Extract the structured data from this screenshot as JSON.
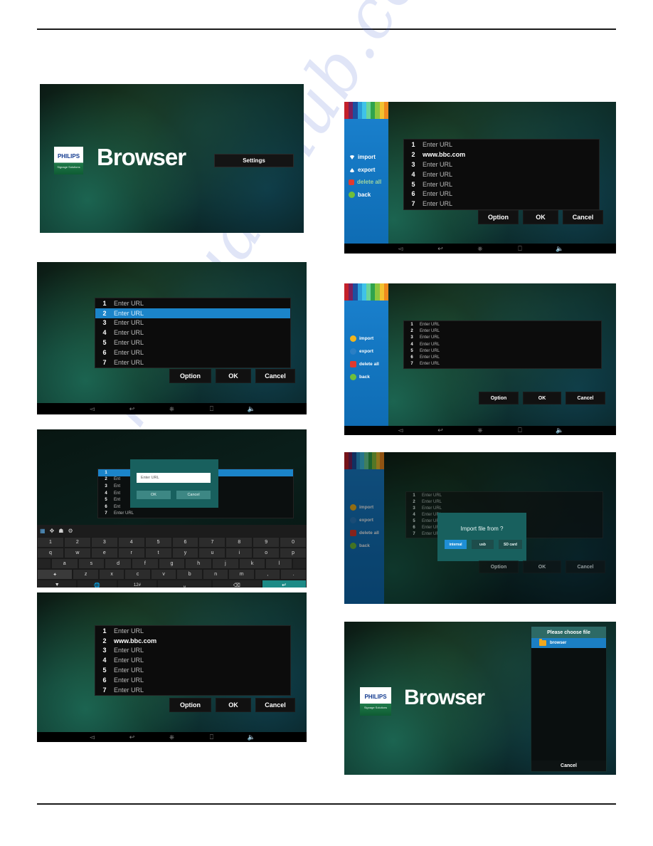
{
  "watermark": "manualshub.com",
  "common": {
    "enter_url": "Enter URL",
    "bbc_url": "www.bbc.com",
    "option": "Option",
    "ok": "OK",
    "cancel": "Cancel",
    "brand": "PHILIPS",
    "brand_tagline": "Signage Solutions",
    "app_title": "Browser",
    "nav_icons": [
      "back-icon",
      "recent-icon",
      "home-icon",
      "apps-icon",
      "volume-icon"
    ]
  },
  "shot1": {
    "name": "browser-home",
    "title": "Browser",
    "settings_label": "Settings"
  },
  "shot2": {
    "name": "url-list-selected",
    "rows": [
      {
        "index": "1",
        "text": "Enter URL",
        "selected": false
      },
      {
        "index": "2",
        "text": "Enter URL",
        "selected": true
      },
      {
        "index": "3",
        "text": "Enter URL",
        "selected": false
      },
      {
        "index": "4",
        "text": "Enter URL",
        "selected": false
      },
      {
        "index": "5",
        "text": "Enter URL",
        "selected": false
      },
      {
        "index": "6",
        "text": "Enter URL",
        "selected": false
      },
      {
        "index": "7",
        "text": "Enter URL",
        "selected": false
      }
    ],
    "buttons": [
      "Option",
      "OK",
      "Cancel"
    ]
  },
  "shot3": {
    "name": "url-keyboard-dialog",
    "dialog": {
      "input_placeholder": "Enter URL",
      "ok": "OK",
      "cancel": "Cancel"
    },
    "rows": [
      "1",
      "2",
      "3",
      "4",
      "5",
      "6",
      "7"
    ],
    "last_row_text": "Enter URL",
    "keyboard": {
      "row_num": [
        "1",
        "2",
        "3",
        "4",
        "5",
        "6",
        "7",
        "8",
        "9",
        "0"
      ],
      "row_q": [
        "q",
        "w",
        "e",
        "r",
        "t",
        "y",
        "u",
        "i",
        "o",
        "p"
      ],
      "row_a": [
        "a",
        "s",
        "d",
        "f",
        "g",
        "h",
        "j",
        "k",
        "l"
      ],
      "row_z": [
        "z",
        "x",
        "c",
        "v",
        "b",
        "n",
        "m",
        ",",
        "."
      ],
      "shift_key": "shift-icon",
      "bottom": [
        "hide-keyboard-icon",
        "globe-icon",
        "12#",
        "space-icon",
        "backspace-icon",
        "enter-icon"
      ],
      "toolbar_icons": [
        "input-method-icon",
        "move-icon",
        "home-icon",
        "settings-icon"
      ]
    }
  },
  "shot4": {
    "name": "url-list-bbc",
    "rows": [
      {
        "index": "1",
        "text": "Enter URL",
        "filled": false
      },
      {
        "index": "2",
        "text": "www.bbc.com",
        "filled": true
      },
      {
        "index": "3",
        "text": "Enter URL",
        "filled": false
      },
      {
        "index": "4",
        "text": "Enter URL",
        "filled": false
      },
      {
        "index": "5",
        "text": "Enter URL",
        "filled": false
      },
      {
        "index": "6",
        "text": "Enter URL",
        "filled": false
      },
      {
        "index": "7",
        "text": "Enter URL",
        "filled": false
      }
    ],
    "buttons": [
      "Option",
      "OK",
      "Cancel"
    ]
  },
  "shot5": {
    "name": "option-menu-bbc",
    "sidebar": [
      {
        "label": "import",
        "icon": "download-icon",
        "color": "#ffffff"
      },
      {
        "label": "export",
        "icon": "upload-icon",
        "color": "#ffffff"
      },
      {
        "label": "delete all",
        "icon": "delete-icon",
        "color": "#9fd6a0"
      },
      {
        "label": "back",
        "icon": "back-icon",
        "color": "#ffffff"
      }
    ],
    "rows": [
      {
        "index": "1",
        "text": "Enter URL",
        "filled": false
      },
      {
        "index": "2",
        "text": "www.bbc.com",
        "filled": true
      },
      {
        "index": "3",
        "text": "Enter URL",
        "filled": false
      },
      {
        "index": "4",
        "text": "Enter URL",
        "filled": false
      },
      {
        "index": "5",
        "text": "Enter URL",
        "filled": false
      },
      {
        "index": "6",
        "text": "Enter URL",
        "filled": false
      },
      {
        "index": "7",
        "text": "Enter URL",
        "filled": false
      }
    ],
    "buttons": [
      "Option",
      "OK",
      "Cancel"
    ]
  },
  "shot6": {
    "name": "option-menu-empty",
    "sidebar": [
      {
        "label": "import",
        "icon": "download-icon"
      },
      {
        "label": "export",
        "icon": "upload-icon"
      },
      {
        "label": "delete all",
        "icon": "delete-icon"
      },
      {
        "label": "back",
        "icon": "back-icon"
      }
    ],
    "rows": [
      {
        "index": "1",
        "text": "Enter URL"
      },
      {
        "index": "2",
        "text": "Enter URL"
      },
      {
        "index": "3",
        "text": "Enter URL"
      },
      {
        "index": "4",
        "text": "Enter URL"
      },
      {
        "index": "5",
        "text": "Enter URL"
      },
      {
        "index": "6",
        "text": "Enter URL"
      },
      {
        "index": "7",
        "text": "Enter URL"
      }
    ],
    "buttons": [
      "Option",
      "OK",
      "Cancel"
    ]
  },
  "shot7": {
    "name": "import-source-dialog",
    "sidebar": [
      {
        "label": "import",
        "icon": "download-icon"
      },
      {
        "label": "export",
        "icon": "upload-icon"
      },
      {
        "label": "delete all",
        "icon": "delete-icon"
      },
      {
        "label": "back",
        "icon": "back-icon"
      }
    ],
    "rows": [
      {
        "index": "1",
        "text": "Enter URL"
      },
      {
        "index": "2",
        "text": "Enter URL"
      },
      {
        "index": "3",
        "text": "Enter URL"
      },
      {
        "index": "4",
        "text": "Enter URL"
      },
      {
        "index": "5",
        "text": "Enter URL"
      },
      {
        "index": "6",
        "text": "Enter URL"
      },
      {
        "index": "7",
        "text": "Enter URL"
      }
    ],
    "dialog": {
      "title": "Import file from ?",
      "options": [
        "internal",
        "usb",
        "SD card"
      ],
      "selected": "internal"
    },
    "buttons": [
      "Option",
      "OK",
      "Cancel"
    ]
  },
  "shot8": {
    "name": "file-chooser",
    "title": "Browser",
    "chooser": {
      "header": "Please choose file",
      "items": [
        {
          "label": "browser",
          "icon": "folder-icon",
          "selected": true
        }
      ],
      "cancel": "Cancel"
    }
  },
  "colors": {
    "accent_blue": "#1b84c9",
    "teal_dialog": "#18605e",
    "folder_orange": "#f0a81e",
    "delete_red": "#e03a2f",
    "back_green": "#6fbf3a"
  }
}
